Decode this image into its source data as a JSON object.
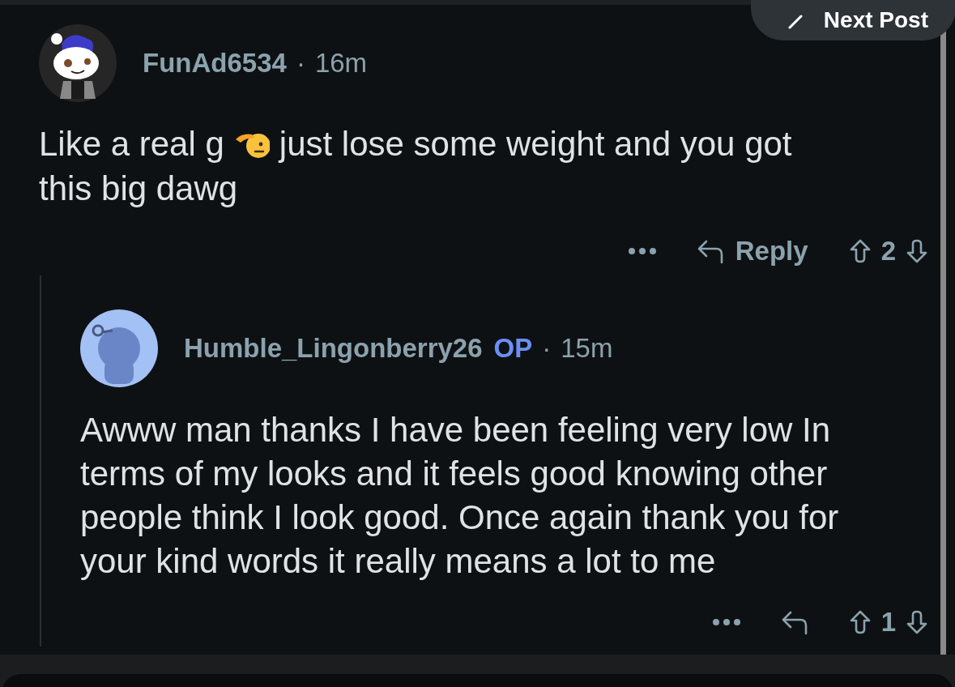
{
  "next_post_button": {
    "label": "Next Post"
  },
  "comments": [
    {
      "username": "FunAd6534",
      "op": false,
      "separator": "·",
      "time": "16m",
      "body_parts": [
        {
          "kind": "text",
          "text": "Like a real g"
        },
        {
          "kind": "emoji"
        },
        {
          "kind": "text",
          "text": "just lose some weight and you got"
        },
        {
          "kind": "text",
          "text": "this big dawg"
        }
      ],
      "reply_label": "Reply",
      "score": "2",
      "replies": [
        {
          "username": "Humble_Lingonberry26",
          "op": true,
          "op_label": "OP",
          "separator": "·",
          "time": "15m",
          "body_parts": [
            {
              "kind": "text",
              "text": "Awww man thanks I have been feeling very low In terms of my looks and it feels good knowing other people think I look good. Once again thank you for your kind words it really means a lot to me"
            }
          ],
          "score": "1"
        }
      ]
    }
  ]
}
